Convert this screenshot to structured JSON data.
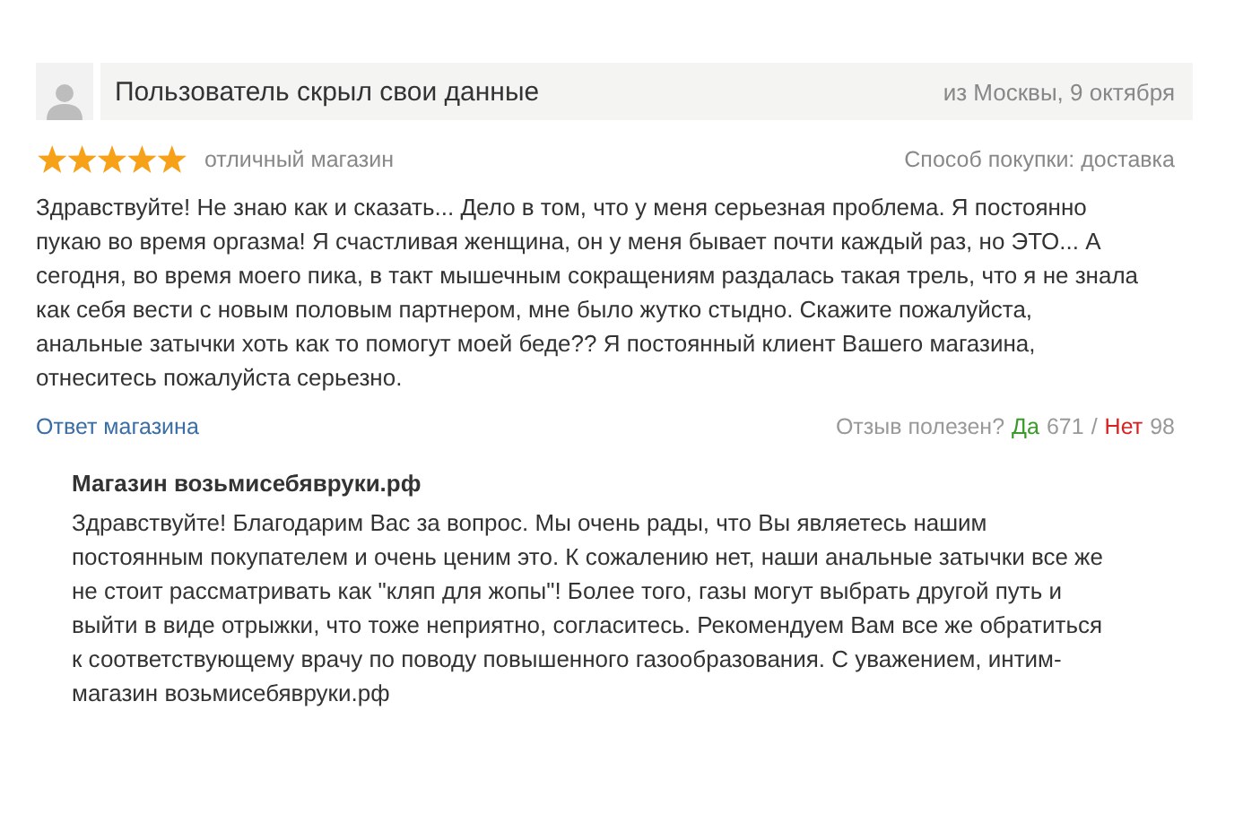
{
  "review": {
    "author": "Пользователь скрыл свои данные",
    "location_date": "из Москвы, 9 октября",
    "stars": 5,
    "title": "отличный магазин",
    "purchase_method": "Способ покупки: доставка",
    "text": "Здравствуйте! Не знаю как и сказать... Дело в том, что у меня серьезная проблема. Я постоянно пукаю во время оргазма! Я счастливая женщина, он у меня бывает почти каждый раз, но ЭТО... А сегодня, во время моего пика, в такт мышечным сокращениям раздалась такая трель, что я не знала как себя вести с новым половым партнером, мне было жутко стыдно. Скажите пожалуйста, анальные затычки хоть как то помогут моей беде?? Я постоянный клиент Вашего магазина, отнеситесь пожалуйста серьезно.",
    "reply_link": "Ответ магазина",
    "helpful_label": "Отзыв полезен?",
    "yes": "Да",
    "yes_count": "671",
    "separator": "/",
    "no": "Нет",
    "no_count": "98"
  },
  "shop_reply": {
    "author": "Магазин возьмисебявруки.рф",
    "text": "Здравствуйте! Благодарим Вас за вопрос. Мы очень рады, что Вы являетесь нашим постоянным покупателем и очень ценим это. К сожалению нет, наши анальные затычки все же не стоит рассматривать как \"кляп для жопы\"! Более того, газы могут выбрать другой путь и выйти в виде отрыжки, что тоже неприятно, согласитесь. Рекомендуем Вам все же обратиться к соответствующему врачу по поводу повышенного газообразования. С уважением, интим-магазин возьмисебявруки.рф"
  }
}
